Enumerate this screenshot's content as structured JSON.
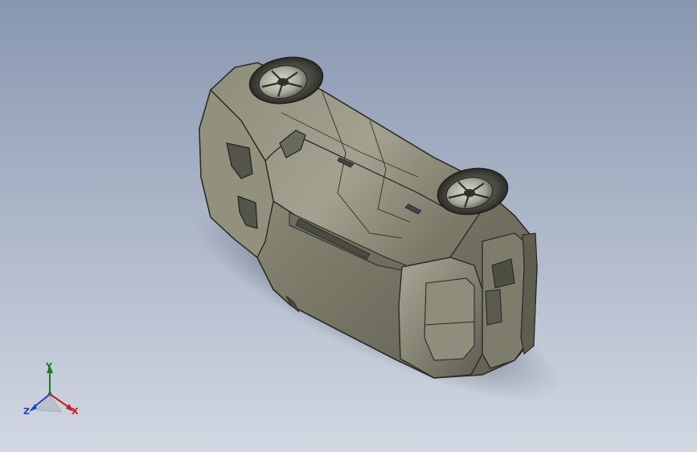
{
  "viewport": {
    "background_top": "#8896b0",
    "background_bottom": "#d2d8e2",
    "model_color": "#8b8a78",
    "edge_color": "#2b2b26"
  },
  "model": {
    "name": "car-body-overturned",
    "wheels": [
      "front-left-wheel",
      "rear-left-wheel"
    ]
  },
  "triad": {
    "x_label": "X",
    "y_label": "Y",
    "z_label": "Z",
    "x_color": "#c22121",
    "y_color": "#1c7a1c",
    "z_color": "#2146c2"
  }
}
